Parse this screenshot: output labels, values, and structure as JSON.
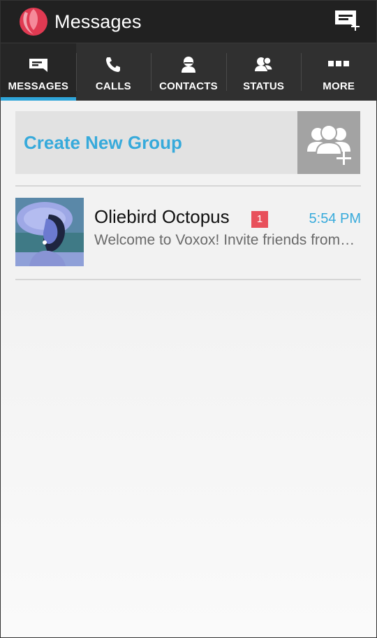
{
  "app": {
    "title": "Messages",
    "accent_color": "#2fa5d9",
    "icons": {
      "logo": "voxox-logo-icon",
      "compose": "new-message-icon"
    }
  },
  "tabs": [
    {
      "label": "MESSAGES",
      "icon": "message-icon",
      "active": true
    },
    {
      "label": "CALLS",
      "icon": "phone-icon",
      "active": false
    },
    {
      "label": "CONTACTS",
      "icon": "contact-icon",
      "active": false
    },
    {
      "label": "STATUS",
      "icon": "status-icon",
      "active": false
    },
    {
      "label": "MORE",
      "icon": "more-dots-icon",
      "active": false
    }
  ],
  "create_group": {
    "label": "Create New Group",
    "icon": "add-group-icon"
  },
  "conversations": [
    {
      "name": "Oliebird Octopus",
      "unread": "1",
      "time": "5:54 PM",
      "preview": "Welcome to Voxox! Invite friends from…",
      "avatar": "avatar-image"
    }
  ]
}
